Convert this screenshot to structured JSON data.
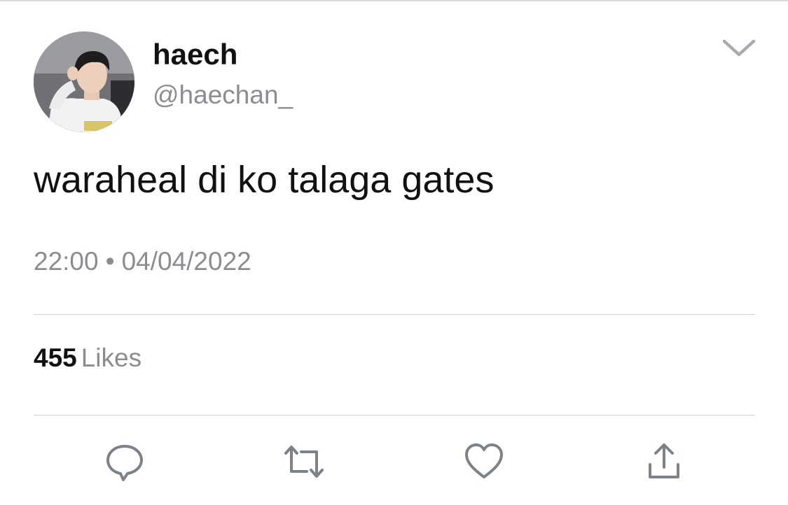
{
  "author": {
    "display_name": "haech",
    "handle": "@haechan_",
    "avatar_icon": "profile-photo"
  },
  "tweet": {
    "text": "waraheal di ko talaga gates",
    "time": "22:00",
    "separator": "•",
    "date": "04/04/2022"
  },
  "stats": {
    "likes_count": "455",
    "likes_label": "Likes"
  },
  "actions": {
    "reply_icon": "comment-icon",
    "retweet_icon": "retweet-icon",
    "like_icon": "heart-icon",
    "share_icon": "share-icon"
  },
  "menu": {
    "icon": "chevron-down-icon"
  },
  "colors": {
    "primary_text": "#111111",
    "secondary_text": "#8a8d91",
    "icon": "#7c8288",
    "divider": "#cfd2d6"
  }
}
